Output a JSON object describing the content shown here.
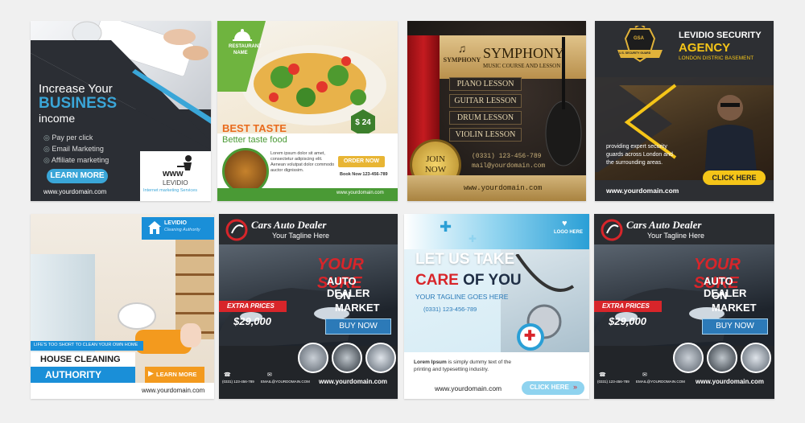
{
  "card1": {
    "headline_1": "Increase Your",
    "headline_2": "BUSINESS",
    "headline_3": "income",
    "bullets": [
      "Pay per click",
      "Email Marketing",
      "Affiliate marketing"
    ],
    "button": "LEARN MORE",
    "domain": "www.yourdomain.com",
    "logo_mark": "www",
    "logo_name": "LEVIDIO",
    "logo_tagline": "Internet marketing Services"
  },
  "card2": {
    "restaurant_1": "RESTAURANT",
    "restaurant_2": "NAME",
    "price": "$ 24",
    "best": "BEST TASTE",
    "better": "Better taste food",
    "body": "Lorem ipsum dolor sit amet, consectetur adipiscing elit. Aenean volutpat dolor commodo auctor dignissim.",
    "order": "ORDER NOW",
    "book": "Book Now 123-456-789",
    "domain": "www.yourdomain.com"
  },
  "card3": {
    "logo_small": "SYMPHONY",
    "title": "SYMPHONY",
    "subtitle": "MUSIC COURSE AND LESSON",
    "lessons": [
      "PIANO LESSON",
      "GUITAR LESSON",
      "DRUM LESSON",
      "VIOLIN LESSON"
    ],
    "join_1": "JOIN",
    "join_2": "NOW",
    "phone": "(0331) 123-456-789",
    "mail": "mail@yourdomain.com",
    "domain": "www.yourdomain.com"
  },
  "card4": {
    "badge": "GSA",
    "badge_ribbon": "U.S. SECURITY GUARD",
    "title_1": "LEVIDIO SECURITY",
    "title_2": "AGENCY",
    "subtitle": "LONDON DISTRIC BASEMENT",
    "body": "providing expert security guards across London and the surrounding areas.",
    "button": "CLICK HERE",
    "domain": "www.yourdomain.com"
  },
  "card5": {
    "brand": "LEVIDIO",
    "brand_sub": "Cleaning Authority",
    "tagline": "LIFE'S TOO SHORT TO CLEAN YOUR OWN HOME",
    "title_1": "HOUSE CLEANING",
    "title_2": "AUTHORITY",
    "button": "LEARN MORE",
    "domain": "www.yourdomain.com"
  },
  "card6": {
    "brand": "Cars Auto Dealer",
    "tagline": "Your Tagline Here",
    "headline_1": "YOUR SURE",
    "headline_2": "AUTO DEALER",
    "headline_3": "ON MARKET",
    "extra": "EXTRA PRICES",
    "price": "$29,000",
    "button": "BUY NOW",
    "phone": "(0331) 123-456-789",
    "email": "EMAIL@YOURDOMAIN.COM",
    "domain": "www.yourdomain.com"
  },
  "card7": {
    "logo": "LOGO HERE",
    "headline_1": "LET US TAKE",
    "headline_2a": "CARE",
    "headline_2b": "OF YOU",
    "tagline": "YOUR TAGLINE GOES HERE",
    "phone": "(0331) 123-456-789",
    "body_bold": "Lorem Ipsum",
    "body": "is simply dummy text of the printing and typesetting industry.",
    "domain": "www.yourdomain.com",
    "button": "CLICK HERE"
  },
  "card8": {
    "brand": "Cars Auto Dealer",
    "tagline": "Your Tagline Here",
    "headline_1": "YOUR SURE",
    "headline_2": "AUTO DEALER",
    "headline_3": "ON MARKET",
    "extra": "EXTRA PRICES",
    "price": "$29,000",
    "button": "BUY NOW",
    "phone": "(0331) 123-456-789",
    "email": "EMAIL@YOURDOMAIN.COM",
    "domain": "www.yourdomain.com"
  },
  "colors": {
    "accent_blue": "#3aa6d8",
    "dealer_red": "#d8252a",
    "security_yellow": "#f5c518",
    "food_orange": "#e96b1c",
    "food_green": "#4a9a35",
    "music_gold": "#c9a24a",
    "medical_blue": "#2a9fd6",
    "cleaning_orange": "#f39a1e"
  }
}
